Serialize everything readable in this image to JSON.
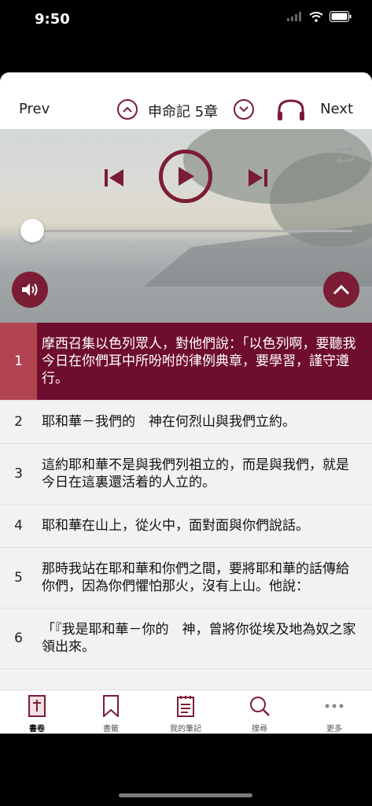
{
  "status_bar": {
    "time": "9:50"
  },
  "nav": {
    "prev_label": "Prev",
    "next_label": "Next",
    "chapter_title": "申命記 5章"
  },
  "colors": {
    "accent": "#7b1d35",
    "active_row": "#6e0d2e",
    "active_num": "#b24452"
  },
  "player": {
    "progress": 0.0
  },
  "verses": [
    {
      "num": "1",
      "text": "摩西召集以色列眾人，對他們說：「以色列啊，要聽我今日在你們耳中所吩咐的律例典章，要學習，謹守遵行。",
      "active": true
    },
    {
      "num": "2",
      "text": "耶和華－我們的　神在何烈山與我們立約。"
    },
    {
      "num": "3",
      "text": "這約耶和華不是與我們列祖立的，而是與我們，就是今日在這裏還活着的人立的。"
    },
    {
      "num": "4",
      "text": "耶和華在山上，從火中，面對面與你們說話。"
    },
    {
      "num": "5",
      "text": "那時我站在耶和華和你們之間，要將耶和華的話傳給你們，因為你們懼怕那火，沒有上山。他說："
    },
    {
      "num": "6",
      "text": "「『我是耶和華－你的　神，曾將你從埃及地為奴之家領出來。"
    }
  ],
  "tabs": [
    {
      "label": "書卷",
      "icon": "bible-icon"
    },
    {
      "label": "書籤",
      "icon": "bookmark-icon"
    },
    {
      "label": "我的筆記",
      "icon": "notes-icon"
    },
    {
      "label": "搜尋",
      "icon": "search-icon"
    },
    {
      "label": "更多",
      "icon": "more-icon"
    }
  ]
}
